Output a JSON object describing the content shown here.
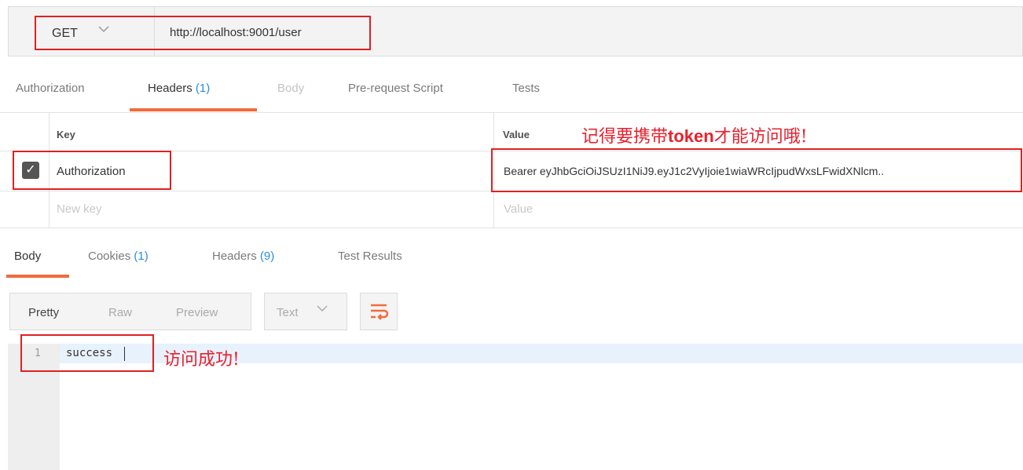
{
  "request": {
    "method": "GET",
    "url": "http://localhost:9001/user"
  },
  "request_tabs": {
    "authorization": "Authorization",
    "headers": "Headers",
    "headers_count": "(1)",
    "body": "Body",
    "pre_request": "Pre-request Script",
    "tests": "Tests"
  },
  "headers_table": {
    "key_header": "Key",
    "value_header": "Value",
    "rows": [
      {
        "key": "Authorization",
        "value": "Bearer eyJhbGciOiJSUzI1NiJ9.eyJ1c2VyIjoie1wiaWRcIjpudWxsLFwidXNlcm..",
        "checked": true
      }
    ],
    "new_key_placeholder": "New key",
    "new_value_placeholder": "Value"
  },
  "annotations": {
    "token_prefix": "记得要携带",
    "token_word": "token",
    "token_suffix": "才能访问哦!",
    "success": "访问成功!"
  },
  "response_tabs": {
    "body": "Body",
    "cookies": "Cookies",
    "cookies_count": "(1)",
    "headers": "Headers",
    "headers_count": "(9)",
    "test_results": "Test Results"
  },
  "response_view": {
    "pretty": "Pretty",
    "raw": "Raw",
    "preview": "Preview",
    "format": "Text"
  },
  "response_body": {
    "line_number": "1",
    "content": "success"
  },
  "colors": {
    "accent": "#f26b3a",
    "count_blue": "#2a8fd8",
    "annotation_red": "#e8212d"
  }
}
